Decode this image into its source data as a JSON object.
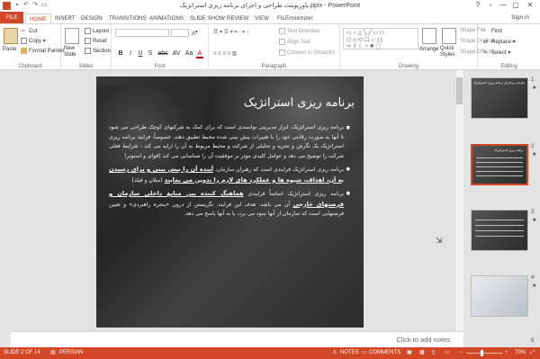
{
  "window": {
    "title": "پاورپوینت طراحی و اجرای برنامه ریزی استراتژیک.pptx - PowerPoint",
    "controls": [
      "?",
      "▫",
      "—",
      "▢",
      "✕"
    ]
  },
  "quick_access": [
    "save-icon",
    "undo-icon",
    "redo-icon",
    "start-slideshow-icon"
  ],
  "tabs": [
    "FILE",
    "HOME",
    "INSERT",
    "DESIGN",
    "TRANSITIONS",
    "ANIMATIONS",
    "SLIDE SHOW",
    "REVIEW",
    "VIEW",
    "FILEminimizer"
  ],
  "active_tab": "HOME",
  "signin": "Sign in",
  "ribbon": {
    "clipboard": {
      "label": "Clipboard",
      "paste": "Paste",
      "cut": "Cut",
      "copy": "Copy",
      "format_painter": "Format Painter"
    },
    "slides": {
      "label": "Slides",
      "new_slide": "New Slide",
      "layout": "Layout",
      "reset": "Reset",
      "section": "Section"
    },
    "font": {
      "label": "Font",
      "buttons": [
        "B",
        "I",
        "U",
        "S",
        "abc",
        "AV",
        "Aa",
        "A"
      ]
    },
    "paragraph": {
      "label": "Paragraph",
      "text_direction": "Text Direction",
      "align_text": "Align Text",
      "convert_smartart": "Convert to SmartArt"
    },
    "drawing": {
      "label": "Drawing",
      "arrange": "Arrange",
      "quick_styles": "Quick Styles",
      "shape_fill": "Shape Fill",
      "shape_outline": "Shape Outline",
      "shape_effects": "Shape Effects"
    },
    "editing": {
      "label": "Editing",
      "find": "Find",
      "replace": "Replace",
      "select": "Select"
    }
  },
  "slide": {
    "title": "برنامه ریزی استراتژیک",
    "bullets": [
      {
        "text": "برنامه ریزی استراتژیک، ابزار مدیریتی توانمندی است که برای کمک به شرکتهای کوچک طراحی می شود تا آنها به صورت رقابتی خود را با تغییرات پیش بینی شده محیط تطبیق دهند. خصوصاً، فرایند برنامه ریزی استراتژیک یک نگرش و تجزیه و تحلیلی از شرکت و محیط مربوط به آن را ارایه می کند - شرایط فعلی شرکت را توضیح می دهد و عوامل کلیدی موثر بر موفقیت آن را شناسایی می کند (قوای و استونر)",
        "emph": ""
      },
      {
        "text": "برنامه ریزی استراتژیک فرایندی است که رهبران سازمان،",
        "emph": "آینده آن را پیش بینی و برای رسیدن به آن، اهداف، شیوه ها و عملکرد های لازم را تدوین می نمایند",
        "tail": "(میلان و فیلد)"
      },
      {
        "text": "برنامه ریزی استراتژیک اساساً فرایندی",
        "emph": "هماهنگ کننده بین منابع داخلی سازمان و فرصتهای خارجی",
        "tail": "آن می باشد. هدف این فرایند، نگریستن از درون «پنجره راهبردی» و تعیین فرصتهایی است که سازمان از آنها سود می برد، یا به آنها پاسخ می دهد."
      }
    ]
  },
  "notes_placeholder": "Click to add notes",
  "thumbnails": [
    {
      "num": "1",
      "caption": "طراحی و اجرای برنامه ریزی استراتژیک",
      "selected": false
    },
    {
      "num": "2",
      "caption": "برنامه ریزی استراتژیک",
      "selected": true
    },
    {
      "num": "3",
      "caption": "",
      "selected": false
    },
    {
      "num": "4",
      "caption": "",
      "selected": false
    },
    {
      "num": "5",
      "caption": "",
      "selected": false
    }
  ],
  "status": {
    "slide_info": "SLIDE 2 OF 14",
    "language": "PERSIAN",
    "notes": "NOTES",
    "comments": "COMMENTS",
    "zoom": "70%"
  },
  "colors": {
    "accent": "#d24726",
    "ribbon_bg": "#ffffff",
    "workspace": "#e3e3e3"
  }
}
